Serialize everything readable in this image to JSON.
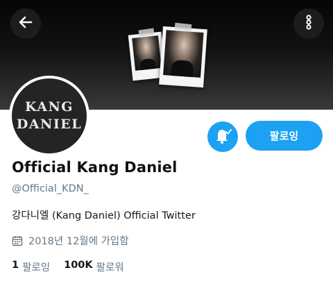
{
  "header": {
    "back_icon": "arrow-left-icon",
    "more_icon": "more-vertical-icon"
  },
  "avatar": {
    "line1": "KANG",
    "line2": "DANIEL"
  },
  "actions": {
    "notify_icon": "bell-check-icon",
    "follow_label": "팔로잉"
  },
  "profile": {
    "display_name": "Official Kang Daniel",
    "handle": "@Official_KDN_",
    "bio": "강다니엘 (Kang Daniel) Official Twitter",
    "joined": "2018년 12월에 가입함"
  },
  "stats": {
    "following_count": "1",
    "following_label": "팔로잉",
    "followers_count": "100K",
    "followers_label": "팔로워"
  },
  "colors": {
    "accent": "#1da1f2",
    "muted_text": "#657786"
  }
}
